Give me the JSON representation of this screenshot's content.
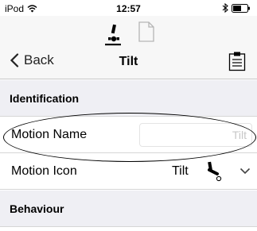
{
  "status_bar": {
    "device": "iPod",
    "time": "12:57"
  },
  "nav": {
    "back_label": "Back",
    "title": "Tilt"
  },
  "sections": {
    "identification": "Identification",
    "behaviour": "Behaviour"
  },
  "motion_name": {
    "label": "Motion Name",
    "placeholder": "Tilt",
    "value": ""
  },
  "motion_icon": {
    "label": "Motion Icon",
    "value": "Tilt"
  }
}
